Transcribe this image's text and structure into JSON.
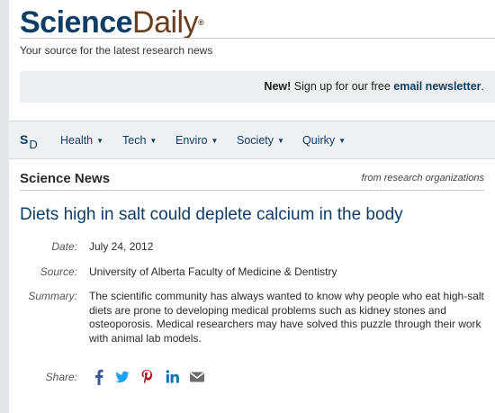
{
  "brand": {
    "logo_science": "Science",
    "logo_daily": "Daily",
    "logo_reg": "®",
    "tagline": "Your source for the latest research news",
    "colors": {
      "navy": "#0e3d66",
      "brown": "#6a3d1c"
    }
  },
  "newsletter": {
    "new_label": "New!",
    "text": " Sign up for our free ",
    "link": "email newsletter",
    "end": "."
  },
  "nav": {
    "logo_s": "S",
    "logo_d": "D",
    "items": [
      {
        "label": "Health"
      },
      {
        "label": "Tech"
      },
      {
        "label": "Enviro"
      },
      {
        "label": "Society"
      },
      {
        "label": "Quirky"
      }
    ],
    "caret": "▼"
  },
  "section": {
    "title": "Science News",
    "subtitle": "from research organizations"
  },
  "article": {
    "headline": "Diets high in salt could deplete calcium in the body",
    "date_label": "Date:",
    "date": "July 24, 2012",
    "source_label": "Source:",
    "source": "University of Alberta Faculty of Medicine & Dentistry",
    "summary_label": "Summary:",
    "summary": "The scientific community has always wanted to know why people who eat high-salt diets are prone to developing medical problems such as kidney stones and osteoporosis. Medical researchers may have solved this puzzle through their work with animal lab models.",
    "share_label": "Share:",
    "share_icons": [
      "facebook-icon",
      "twitter-icon",
      "pinterest-icon",
      "linkedin-icon",
      "email-icon"
    ]
  }
}
